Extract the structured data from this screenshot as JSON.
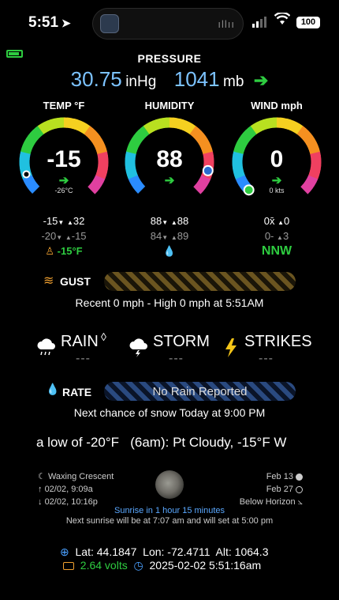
{
  "status": {
    "time": "5:51",
    "battery": "100"
  },
  "pressure": {
    "title": "PRESSURE",
    "inhg": "30.75",
    "inhg_unit": "inHg",
    "mb": "1041",
    "mb_unit": "mb",
    "trend_icon": "arrow-right-icon"
  },
  "temp": {
    "title": "TEMP °F",
    "value": "-15",
    "sub": "-26°C",
    "low": "-15",
    "high": "32",
    "low2": "-20",
    "high2": "-15",
    "feels": "-15°F",
    "gauge_fraction": 0.1
  },
  "humidity": {
    "title": "HUMIDITY",
    "value": "88",
    "low": "88",
    "high": "88",
    "low2": "84",
    "high2": "89",
    "gauge_fraction": 0.88
  },
  "wind": {
    "title": "WIND mph",
    "value": "0",
    "sub": "0 kts",
    "avg": "0x̄",
    "peak": "0",
    "avg2": "0-",
    "peak2": "3",
    "dir": "NNW",
    "gauge_fraction": 0.0
  },
  "gust": {
    "label": "GUST",
    "summary": "Recent 0 mph  -  High 0 mph at 5:51AM"
  },
  "weather": {
    "rain": "RAIN",
    "storm": "STORM",
    "strikes": "STRIKES",
    "dash": "---"
  },
  "rate": {
    "label": "RATE",
    "status": "No Rain Reported",
    "forecast": "Next chance of snow Today at 9:00 PM"
  },
  "ticker": {
    "text": "a low of -20°F   (6am): Pt Cloudy, -15°F W"
  },
  "moon": {
    "phase": "Waxing Crescent",
    "rise": "02/02, 9:09a",
    "set": "02/02, 10:16p",
    "full_date": "Feb 13",
    "new_date": "Feb 27",
    "position": "Below Horizon",
    "sunrise_in": "Sunrise in 1 hour 15 minutes",
    "next_sun": "Next sunrise will be at 7:07 am and will set at 5:00 pm"
  },
  "footer": {
    "lat": "Lat: 44.1847",
    "lon": "Lon: -72.4711",
    "alt": "Alt: 1064.3",
    "volts": "2.64 volts",
    "datetime": "2025-02-02 5:51:16am"
  },
  "colors": {
    "accent_blue": "#7cc3ff",
    "green": "#2ecc40",
    "hatch_gold": "#6b5520",
    "hatch_blue": "#2a4a80"
  }
}
